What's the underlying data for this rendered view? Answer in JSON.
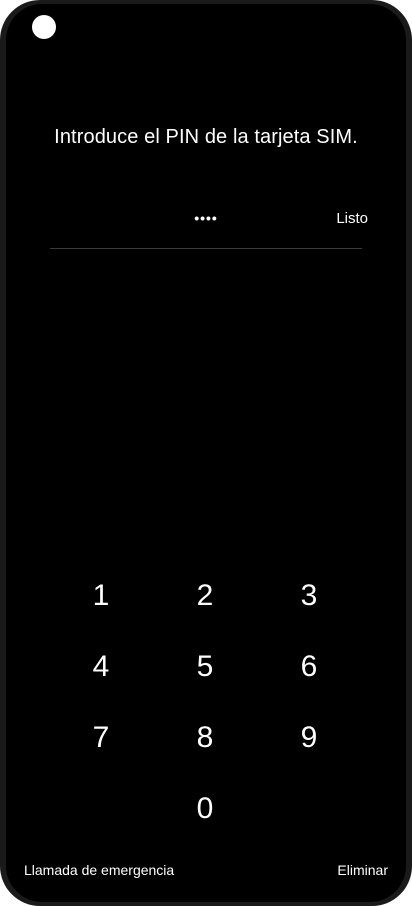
{
  "sim_lock": {
    "title": "Introduce el PIN de la tarjeta SIM.",
    "pin_masked": "••••",
    "done_label": "Listo"
  },
  "keypad": {
    "keys": [
      "1",
      "2",
      "3",
      "4",
      "5",
      "6",
      "7",
      "8",
      "9",
      "0"
    ]
  },
  "footer": {
    "emergency_call_label": "Llamada de emergencia",
    "delete_label": "Eliminar"
  },
  "colors": {
    "background": "#000000",
    "text": "#ffffff",
    "divider": "#3a3a3a"
  }
}
